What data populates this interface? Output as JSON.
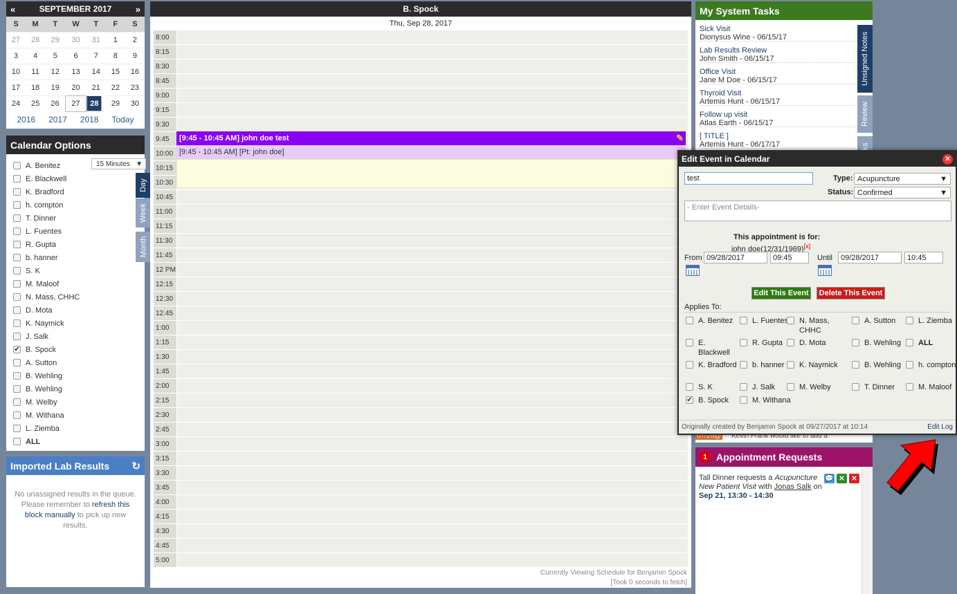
{
  "minical": {
    "prev": "«",
    "next": "»",
    "title": "SEPTEMBER 2017",
    "weekdays": [
      "S",
      "M",
      "T",
      "W",
      "T",
      "F",
      "S"
    ],
    "weeks": [
      [
        "27",
        "28",
        "29",
        "30",
        "31",
        "1",
        "2"
      ],
      [
        "3",
        "4",
        "5",
        "6",
        "7",
        "8",
        "9"
      ],
      [
        "10",
        "11",
        "12",
        "13",
        "14",
        "15",
        "16"
      ],
      [
        "17",
        "18",
        "19",
        "20",
        "21",
        "22",
        "23"
      ],
      [
        "24",
        "25",
        "26",
        "27",
        "28",
        "29",
        "30"
      ]
    ],
    "years": [
      "2016",
      "2017",
      "2018",
      "Today"
    ]
  },
  "calopts": {
    "title": "Calendar Options",
    "interval": "15 Minutes",
    "tabs": [
      "Day",
      "Week",
      "Month"
    ],
    "providers": [
      {
        "name": "A. Benitez",
        "checked": false
      },
      {
        "name": "E. Blackwell",
        "checked": false
      },
      {
        "name": "K. Bradford",
        "checked": false
      },
      {
        "name": "h. compton",
        "checked": false
      },
      {
        "name": "T. Dinner",
        "checked": false
      },
      {
        "name": "L. Fuentes",
        "checked": false
      },
      {
        "name": "R. Gupta",
        "checked": false
      },
      {
        "name": "b. hanner",
        "checked": false
      },
      {
        "name": "S. K",
        "checked": false
      },
      {
        "name": "M. Maloof",
        "checked": false
      },
      {
        "name": "N. Mass, CHHC",
        "checked": false
      },
      {
        "name": "D. Mota",
        "checked": false
      },
      {
        "name": "K. Naymick",
        "checked": false
      },
      {
        "name": "J. Salk",
        "checked": false
      },
      {
        "name": "B. Spock",
        "checked": true
      },
      {
        "name": "A. Sutton",
        "checked": false
      },
      {
        "name": "B. Wehling",
        "checked": false
      },
      {
        "name": "B. Wehling",
        "checked": false
      },
      {
        "name": "M. Welby",
        "checked": false
      },
      {
        "name": "M. Withana",
        "checked": false
      },
      {
        "name": "L. Ziemba",
        "checked": false
      },
      {
        "name": "ALL",
        "checked": false
      }
    ]
  },
  "labs": {
    "title": "Imported Lab Results",
    "msg1": "No unassigned results in the queue. Please remember to",
    "link": "refresh this block manually",
    "msg2": "to pick up new results."
  },
  "schedule": {
    "provider": "B. Spock",
    "date": "Thu, Sep 28, 2017",
    "times": [
      "8:00",
      "8:15",
      "8:30",
      "8:45",
      "9:00",
      "9:15",
      "9:30",
      "9:45",
      "10:00",
      "10:15",
      "10:30",
      "10:45",
      "11:00",
      "11:15",
      "11:30",
      "11:45",
      "12 PM",
      "12:15",
      "12:30",
      "12:45",
      "1:00",
      "1:15",
      "1:30",
      "1:45",
      "2:00",
      "2:15",
      "2:30",
      "2:45",
      "3:00",
      "3:15",
      "3:30",
      "3:45",
      "4:00",
      "4:15",
      "4:30",
      "4:45",
      "5:00"
    ],
    "event_title": "[9:45 - 10:45 AM] john doe test",
    "event_patient": "[9:45 - 10:45 AM] [Pt: john doe]",
    "footer1": "Currently Viewing Schedule for Benjamin Spock",
    "footer2": "[Took 0 seconds to fetch]"
  },
  "tasks": {
    "title": "My System Tasks",
    "items": [
      {
        "title": "Sick Visit",
        "sub": "Dionysus Wine - 06/15/17"
      },
      {
        "title": "Lab Results Review",
        "sub": "John Smith - 06/15/17"
      },
      {
        "title": "Office Visit",
        "sub": "Jane M Doe - 06/15/17"
      },
      {
        "title": "Thyroid Visit",
        "sub": "Artemis Hunt - 06/15/17"
      },
      {
        "title": "Follow up visit",
        "sub": "Atlas Earth - 06/15/17"
      },
      {
        "title": "[ TITLE ]",
        "sub": "Artemis Hunt - 06/17/17"
      }
    ],
    "tabs": [
      "Unsigned Notes",
      "Review",
      "ks"
    ]
  },
  "behind": {
    "date": "07/26@",
    "text": "Kevin Frank would like to add a"
  },
  "appt": {
    "badge": "1",
    "title": "Appointment Requests",
    "req_a": "Tall Dinner requests a ",
    "req_type": "Acupuncture New Patient Visit",
    "req_b": " with ",
    "req_prov": "Jonas Salk",
    "req_c": " on",
    "req_time": "Sep 21, 13:30 - 14:30"
  },
  "modal": {
    "title": "Edit Event in Calendar",
    "event_name": "test",
    "type_label": "Type:",
    "type_value": "Acupuncture",
    "status_label": "Status:",
    "status_value": "Confirmed",
    "details_placeholder": "- Enter Event Details-",
    "for_label": "This appointment is for:",
    "for_patient": "john doe(12/31/1969)",
    "remove": "[x]",
    "from_label": "From",
    "from_date": "09/28/2017",
    "from_time": "09:45",
    "until_label": "Until",
    "until_date": "09/28/2017",
    "until_time": "10:45",
    "edit_btn": "Edit This Event",
    "delete_btn": "Delete This Event",
    "applies_label": "Applies To:",
    "applies": [
      {
        "name": "A. Benitez",
        "checked": false
      },
      {
        "name": "L. Fuentes",
        "checked": false
      },
      {
        "name": "N. Mass, CHHC",
        "checked": false
      },
      {
        "name": "A. Sutton",
        "checked": false
      },
      {
        "name": "L. Ziemba",
        "checked": false
      },
      {
        "name": "E. Blackwell",
        "checked": false
      },
      {
        "name": "R. Gupta",
        "checked": false
      },
      {
        "name": "D. Mota",
        "checked": false
      },
      {
        "name": "B. Wehling",
        "checked": false
      },
      {
        "name": "ALL",
        "checked": false
      },
      {
        "name": "K. Bradford",
        "checked": false
      },
      {
        "name": "b. hanner",
        "checked": false
      },
      {
        "name": "K. Naymick",
        "checked": false
      },
      {
        "name": "B. Wehling",
        "checked": false
      },
      {
        "name": "h. compton",
        "checked": false
      },
      {
        "name": "S. K",
        "checked": false
      },
      {
        "name": "J. Salk",
        "checked": false
      },
      {
        "name": "M. Welby",
        "checked": false
      },
      {
        "name": "T. Dinner",
        "checked": false
      },
      {
        "name": "M. Maloof",
        "checked": false
      },
      {
        "name": "B. Spock",
        "checked": true
      },
      {
        "name": "M. Withana",
        "checked": false
      }
    ],
    "footer": "Originally created by Benjamin Spock at 09/27/2017 at 10:14",
    "editlog": "Edit Log"
  },
  "colors": {
    "accent": "#1e3e67",
    "event": "#8a00f0",
    "arrow": "#ff0000"
  }
}
